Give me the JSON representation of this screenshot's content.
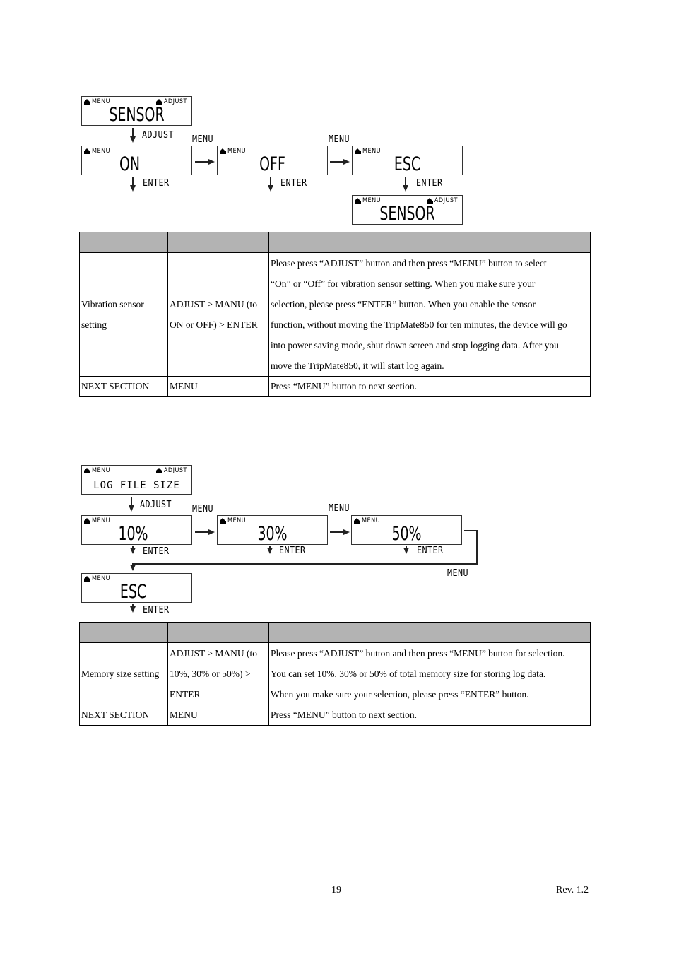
{
  "section1": {
    "flow": {
      "start_screen": {
        "left_indicator": "MENU",
        "right_indicator": "ADJUST",
        "text": "SENSOR"
      },
      "adjust_label": "ADJUST",
      "screens": [
        {
          "left_indicator": "MENU",
          "text": "ON",
          "enter_label": "ENTER"
        },
        {
          "left_indicator": "MENU",
          "text": "OFF",
          "enter_label": "ENTER"
        },
        {
          "left_indicator": "MENU",
          "text": "ESC",
          "enter_label": "ENTER"
        }
      ],
      "menu_labels": [
        "MENU",
        "MENU"
      ],
      "end_screen": {
        "left_indicator": "MENU",
        "right_indicator": "ADJUST",
        "text": "SENSOR"
      }
    },
    "table": {
      "headers": [
        "",
        "",
        ""
      ],
      "rows": [
        {
          "function": [
            "Vibration sensor",
            "setting"
          ],
          "operation": [
            "ADJUST > MANU (to",
            "ON or OFF) > ENTER"
          ],
          "description": [
            "Please press “ADJUST” button and then press “MENU” button to select",
            "“On” or “Off” for vibration sensor setting. When you make sure your",
            "selection, please press “ENTER” button. When you enable the sensor",
            "function, without moving the TripMate850 for ten minutes, the device will go",
            "into power saving mode, shut down screen and stop logging data. After you",
            "move the TripMate850, it will start log again."
          ]
        },
        {
          "function": [
            "NEXT SECTION"
          ],
          "operation": [
            "MENU"
          ],
          "description": [
            "Press “MENU” button to next section."
          ]
        }
      ]
    }
  },
  "section2": {
    "flow": {
      "start_screen": {
        "left_indicator": "MENU",
        "right_indicator": "ADJUST",
        "text": "LOG FILE SIZE"
      },
      "adjust_label": "ADJUST",
      "screens": [
        {
          "left_indicator": "MENU",
          "text": "10%",
          "enter_label": "ENTER"
        },
        {
          "left_indicator": "MENU",
          "text": "30%",
          "enter_label": "ENTER"
        },
        {
          "left_indicator": "MENU",
          "text": "50%",
          "enter_label": "ENTER"
        }
      ],
      "menu_labels": [
        "MENU",
        "MENU",
        "MENU"
      ],
      "esc_screen": {
        "left_indicator": "MENU",
        "text": "ESC",
        "enter_label": "ENTER"
      }
    },
    "table": {
      "headers": [
        "",
        "",
        ""
      ],
      "rows": [
        {
          "function": [
            "Memory size setting"
          ],
          "operation": [
            "ADJUST > MANU (to",
            "10%, 30% or 50%) >",
            "ENTER"
          ],
          "description": [
            "Please press “ADJUST” button and then press “MENU” button for selection.",
            "You can set 10%, 30% or 50% of total memory size for storing log data.",
            "When you make sure your selection, please press “ENTER” button."
          ]
        },
        {
          "function": [
            "NEXT SECTION"
          ],
          "operation": [
            "MENU"
          ],
          "description": [
            "Press “MENU” button to next section."
          ]
        }
      ]
    }
  },
  "footer": {
    "page_number": "19",
    "revision": "Rev. 1.2"
  }
}
